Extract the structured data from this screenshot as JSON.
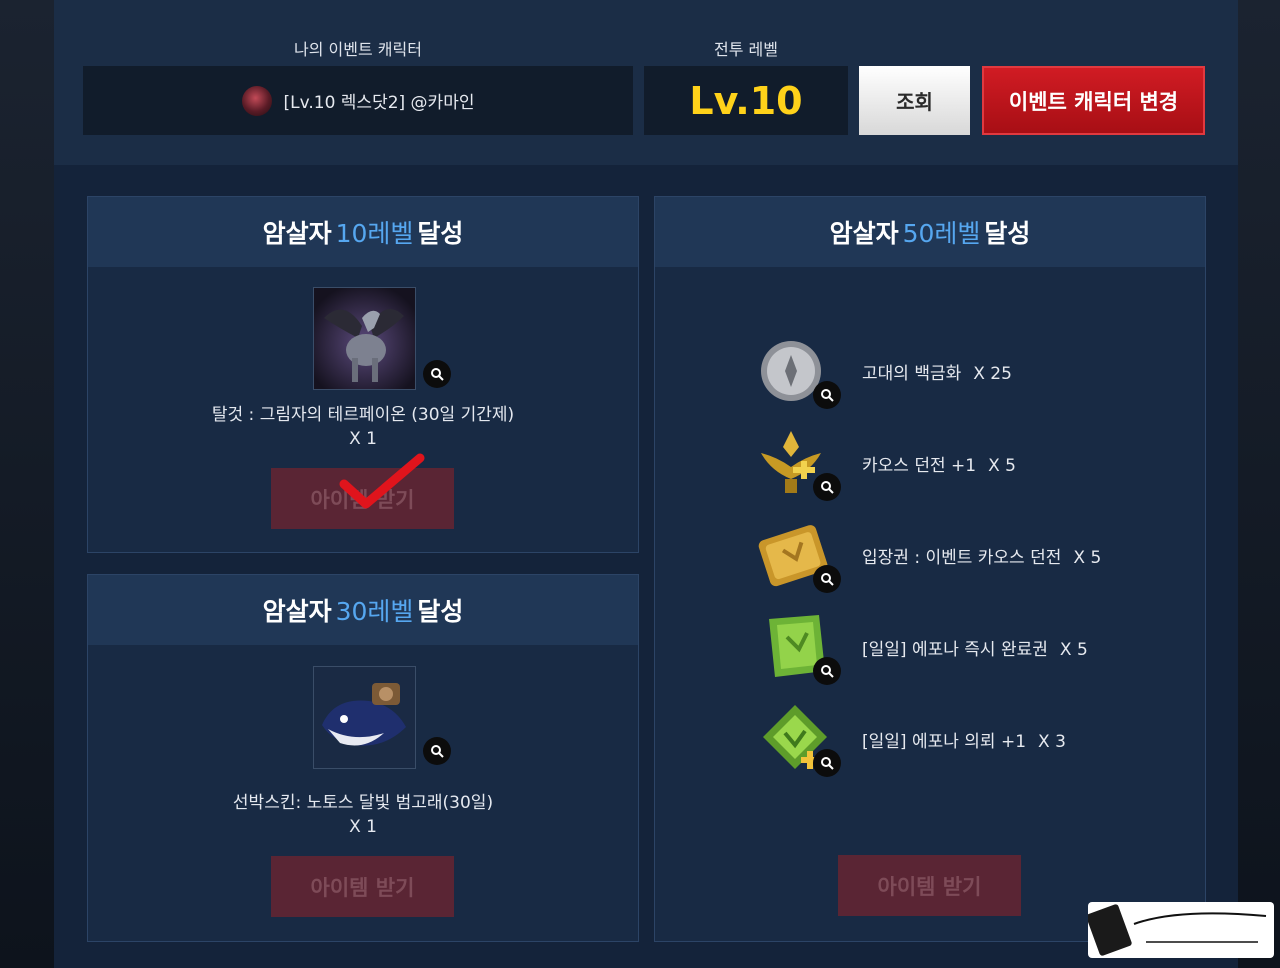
{
  "header": {
    "character_label": "나의 이벤트 캐릭터",
    "level_label": "전투 레벨",
    "character_name": "[Lv.10 렉스닷2] @카마인",
    "level_value": "Lv.10",
    "query_button": "조회",
    "change_button": "이벤트 캐릭터 변경"
  },
  "panels": [
    {
      "title_pre": "암살자",
      "title_num": "10레벨",
      "title_post": "달성",
      "item_name": "탈것 : 그림자의 테르페이온 (30일 기간제)",
      "item_qty": "X 1",
      "button": "아이템 받기",
      "claimed": true
    },
    {
      "title_pre": "암살자",
      "title_num": "30레벨",
      "title_post": "달성",
      "item_name": "선박스킨: 노토스 달빛 범고래(30일)",
      "item_qty": "X 1",
      "button": "아이템 받기",
      "claimed": false
    },
    {
      "title_pre": "암살자",
      "title_num": "50레벨",
      "title_post": "달성",
      "rewards": [
        {
          "name": "고대의 백금화",
          "qty": "X 25",
          "icon": "coin-icon"
        },
        {
          "name": "카오스 던전 +1",
          "qty": "X 5",
          "icon": "chaos-dungeon-icon"
        },
        {
          "name": "입장권 : 이벤트 카오스 던전",
          "qty": "X 5",
          "icon": "ticket-icon"
        },
        {
          "name": "[일일] 에포나 즉시 완료권",
          "qty": "X 5",
          "icon": "scroll-icon"
        },
        {
          "name": "[일일] 에포나 의뢰 +1",
          "qty": "X 3",
          "icon": "epona-quest-icon"
        }
      ],
      "button": "아이템 받기",
      "claimed": false
    }
  ],
  "colors": {
    "accent_number": "#56a7f0",
    "level_yellow": "#ffd21a",
    "change_red": "#c8161d",
    "disabled_button": "#5a2534"
  }
}
